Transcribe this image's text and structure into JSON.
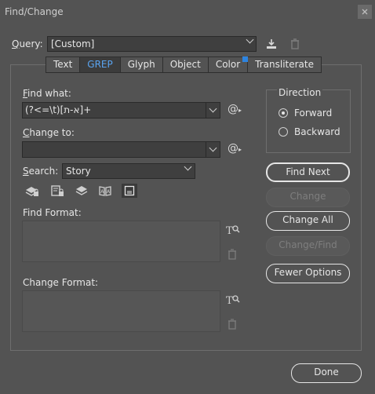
{
  "window": {
    "title": "Find/Change"
  },
  "query": {
    "label": "Query:",
    "value": "[Custom]"
  },
  "tabs": [
    {
      "label": "Text",
      "active": false
    },
    {
      "label": "GREP",
      "active": true
    },
    {
      "label": "Glyph",
      "active": false
    },
    {
      "label": "Object",
      "active": false
    },
    {
      "label": "Color",
      "active": false
    },
    {
      "label": "Transliterate",
      "active": false
    }
  ],
  "find_what": {
    "label": "Find what:",
    "value": "(?<=\\t)[א-ת]+"
  },
  "change_to": {
    "label": "Change to:",
    "value": ""
  },
  "search": {
    "label": "Search:",
    "value": "Story"
  },
  "direction": {
    "label": "Direction",
    "options": [
      {
        "label": "Forward",
        "selected": true
      },
      {
        "label": "Backward",
        "selected": false
      }
    ]
  },
  "buttons": {
    "find_next": "Find Next",
    "change": "Change",
    "change_all": "Change All",
    "change_find": "Change/Find",
    "fewer_options": "Fewer Options",
    "done": "Done"
  },
  "find_format": {
    "label": "Find Format:"
  },
  "change_format": {
    "label": "Change Format:"
  },
  "special_char_glyph": "@",
  "colors": {
    "accent": "#2d84e0",
    "active_tab_text": "#5aa4f0"
  }
}
